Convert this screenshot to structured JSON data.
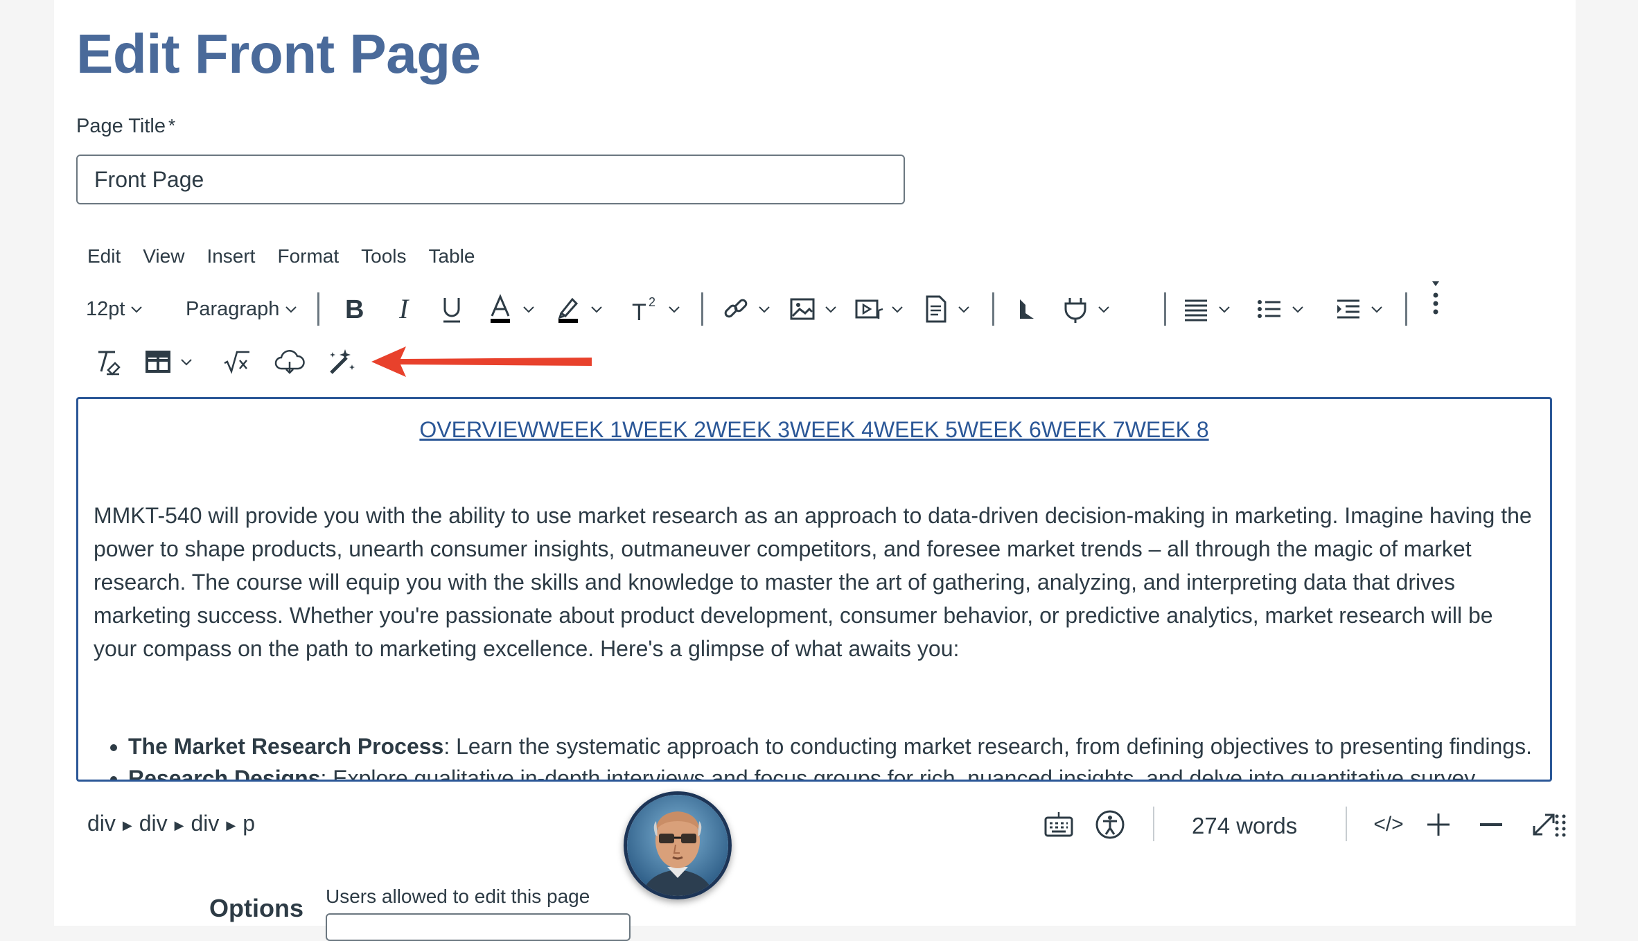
{
  "page": {
    "heading": "Edit Front Page",
    "title_label": "Page Title",
    "required_mark": "*",
    "title_value": "Front Page"
  },
  "menubar": {
    "items": [
      "Edit",
      "View",
      "Insert",
      "Format",
      "Tools",
      "Table"
    ]
  },
  "toolbar": {
    "font_size": "12pt",
    "block_format": "Paragraph",
    "icons": [
      "bold-icon",
      "italic-icon",
      "underline-icon",
      "text-color-icon",
      "highlight-icon",
      "superscript-icon",
      "link-icon",
      "image-icon",
      "media-icon",
      "document-icon",
      "lti-apps-icon",
      "plugin-icon",
      "align-icon",
      "bullet-list-icon",
      "indent-icon",
      "more-icon",
      "clear-format-icon",
      "table-icon",
      "equation-icon",
      "cloud-icon",
      "magic-wand-icon"
    ]
  },
  "annotation": {
    "arrow_color": "#e8412c"
  },
  "editor": {
    "nav_links": "OVERVIEWWEEK 1WEEK 2WEEK 3WEEK 4WEEK 5WEEK 6WEEK 7WEEK 8",
    "intro": "MMKT-540 will provide you with the ability to use market research as an approach to data-driven decision-making in marketing. Imagine having the power to shape products, unearth consumer insights, outmaneuver competitors, and foresee market trends – all through the magic of market research. The course will equip you with the skills and knowledge to master the art of gathering, analyzing, and interpreting data that drives marketing success. Whether you're passionate about product development, consumer behavior, or predictive analytics, market research will be your compass on the path to marketing excellence. Here's a glimpse of what awaits you:",
    "bullets": [
      {
        "title": "The Market Research Process",
        "text": ": Learn the systematic approach to conducting market research, from defining objectives to presenting findings."
      },
      {
        "title": "Research Designs",
        "text": ": Explore qualitative in-depth interviews and focus groups for rich, nuanced insights, and delve into quantitative survey"
      }
    ]
  },
  "statusbar": {
    "breadcrumb": [
      "div",
      "div",
      "div",
      "p"
    ],
    "word_count": "274 words",
    "html_toggle": "</>"
  },
  "options": {
    "heading": "Options",
    "users_label": "Users allowed to edit this page"
  },
  "colors": {
    "heading": "#4a6a9a",
    "link": "#2b5797",
    "editor_border": "#2b5797",
    "text": "#2d3b45"
  }
}
